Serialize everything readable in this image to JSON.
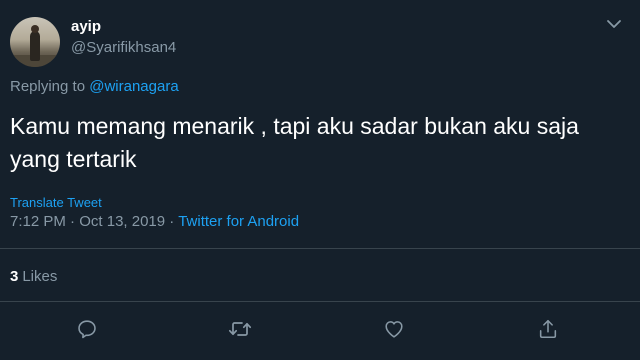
{
  "author": {
    "display_name": "ayip",
    "handle": "@Syarifikhsan4"
  },
  "reply": {
    "prefix": "Replying to",
    "target": "@wiranagara"
  },
  "tweet": {
    "text": "Kamu memang menarik , tapi aku sadar bukan aku saja yang tertarik"
  },
  "translate_label": "Translate Tweet",
  "meta": {
    "time": "7:12 PM",
    "separator": " · ",
    "date": "Oct 13, 2019",
    "separator2": " · ",
    "source": "Twitter for Android"
  },
  "stats": {
    "likes_count": "3",
    "likes_label": "Likes"
  },
  "actions": {
    "reply_icon": "reply-icon",
    "retweet_icon": "retweet-icon",
    "like_icon": "heart-icon",
    "share_icon": "share-icon"
  },
  "colors": {
    "background": "#15202b",
    "accent": "#1da1f2",
    "secondary_text": "#8899a6",
    "divider": "#38444d"
  }
}
